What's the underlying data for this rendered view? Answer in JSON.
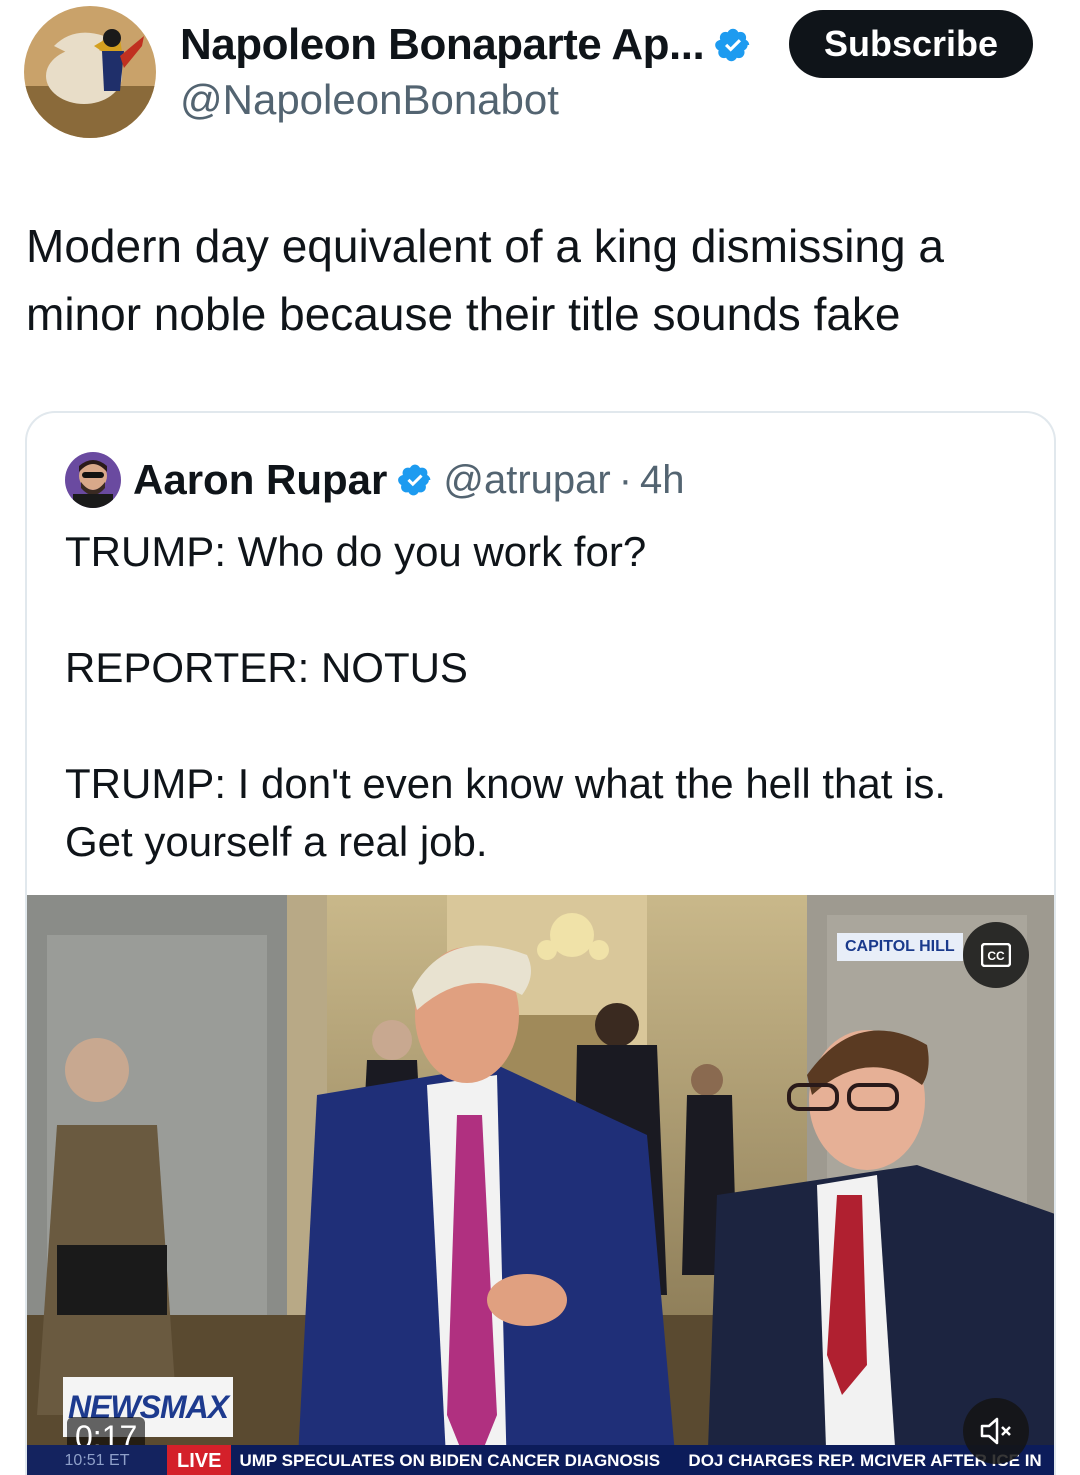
{
  "author": {
    "display_name": "Napoleon Bonaparte Ap...",
    "handle": "@NapoleonBonabot",
    "verified_icon": "verified-badge-icon"
  },
  "actions": {
    "subscribe_label": "Subscribe"
  },
  "tweet": {
    "text": "Modern day equivalent of a king dismissing a minor noble because their title sounds fake"
  },
  "quoted": {
    "display_name": "Aaron Rupar",
    "handle": "@atrupar",
    "separator": "·",
    "time": "4h",
    "text": "TRUMP: Who do you work for?\n\nREPORTER: NOTUS\n\nTRUMP: I don't even know what the hell that is. Get yourself a real job."
  },
  "video": {
    "duration": "0:17",
    "location_tag": "CAPITOL HILL",
    "network_logo": "NEWSMAX",
    "ticker_time": "10:51 ET",
    "ticker_live": "LIVE",
    "ticker_text": "UMP SPECULATES ON BIDEN CANCER DIAGNOSIS      DOJ CHARGES REP. MCIVER AFTER ICE IN",
    "cc_icon": "closed-captions-icon",
    "mute_icon": "muted-speaker-icon"
  },
  "colors": {
    "text_primary": "#0f1419",
    "text_secondary": "#536471",
    "verified_blue": "#1d9bf0",
    "button_bg": "#0f1419",
    "ticker_bg": "#0c1c5a",
    "live_red": "#d4202a"
  }
}
